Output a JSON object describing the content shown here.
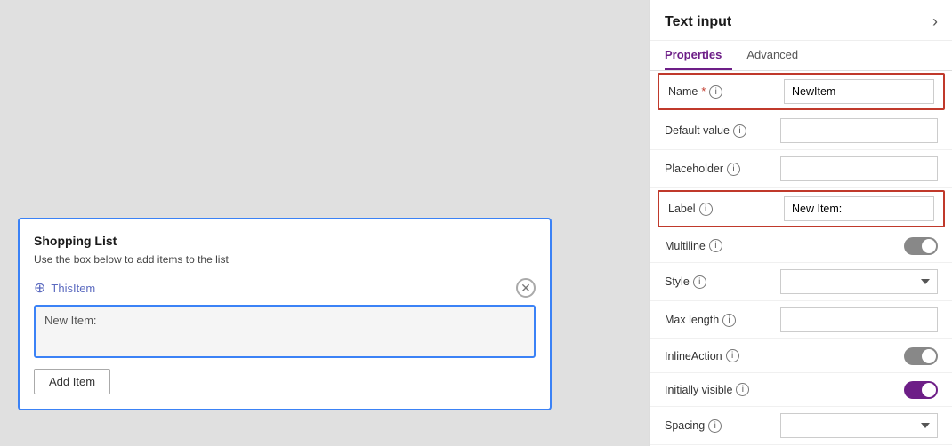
{
  "canvas": {
    "card": {
      "title": "Shopping List",
      "subtitle": "Use the box below to add items to the list",
      "item_label": "ThisItem",
      "text_input_label": "New Item:",
      "add_button_label": "Add Item"
    }
  },
  "panel": {
    "title": "Text input",
    "chevron": "›",
    "tabs": [
      {
        "id": "properties",
        "label": "Properties",
        "active": true
      },
      {
        "id": "advanced",
        "label": "Advanced",
        "active": false
      }
    ],
    "properties": [
      {
        "id": "name",
        "label": "Name",
        "required": true,
        "info": true,
        "type": "input",
        "value": "NewItem",
        "highlighted": true
      },
      {
        "id": "default_value",
        "label": "Default value",
        "info": true,
        "type": "input",
        "value": ""
      },
      {
        "id": "placeholder",
        "label": "Placeholder",
        "info": true,
        "type": "input",
        "value": ""
      },
      {
        "id": "label",
        "label": "Label",
        "info": true,
        "type": "input",
        "value": "New Item:",
        "highlighted": true
      },
      {
        "id": "multiline",
        "label": "Multiline",
        "info": true,
        "type": "toggle",
        "value": "on"
      },
      {
        "id": "style",
        "label": "Style",
        "info": true,
        "type": "select",
        "value": ""
      },
      {
        "id": "max_length",
        "label": "Max length",
        "info": true,
        "type": "input",
        "value": ""
      },
      {
        "id": "inline_action",
        "label": "InlineAction",
        "info": true,
        "type": "toggle",
        "value": "on"
      },
      {
        "id": "initially_visible",
        "label": "Initially visible",
        "info": true,
        "type": "toggle",
        "value": "purple"
      },
      {
        "id": "spacing",
        "label": "Spacing",
        "info": true,
        "type": "select",
        "value": ""
      }
    ],
    "info_icon": "i"
  }
}
